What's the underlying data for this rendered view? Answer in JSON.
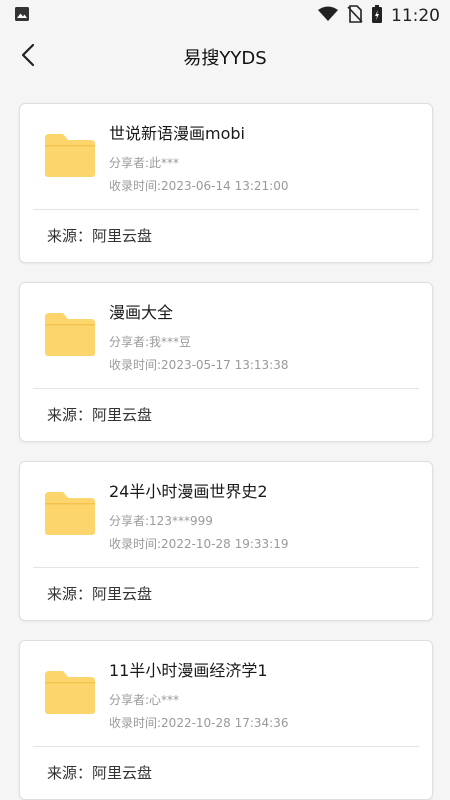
{
  "status": {
    "time": "11:20",
    "icons": [
      "image-icon",
      "wifi-icon",
      "no-sim-icon",
      "battery-icon"
    ]
  },
  "app_bar": {
    "title": "易搜YYDS",
    "back_icon": "back-arrow-icon"
  },
  "colors": {
    "background": "#f5f5f5",
    "folder": "#fcd56d",
    "card_border": "#dedede",
    "secondary_text": "#9a9a9a"
  },
  "results": [
    {
      "title": "世说新语漫画mobi",
      "sharer": "分享者:此***",
      "time": "收录时间:2023-06-14 13:21:00",
      "source": "来源：阿里云盘"
    },
    {
      "title": "漫画大全",
      "sharer": "分享者:我***豆",
      "time": "收录时间:2023-05-17 13:13:38",
      "source": "来源：阿里云盘"
    },
    {
      "title": "24半小时漫画世界史2",
      "sharer": "分享者:123***999",
      "time": "收录时间:2022-10-28 19:33:19",
      "source": "来源：阿里云盘"
    },
    {
      "title": "11半小时漫画经济学1",
      "sharer": "分享者:心***",
      "time": "收录时间:2022-10-28 17:34:36",
      "source": "来源：阿里云盘"
    }
  ]
}
